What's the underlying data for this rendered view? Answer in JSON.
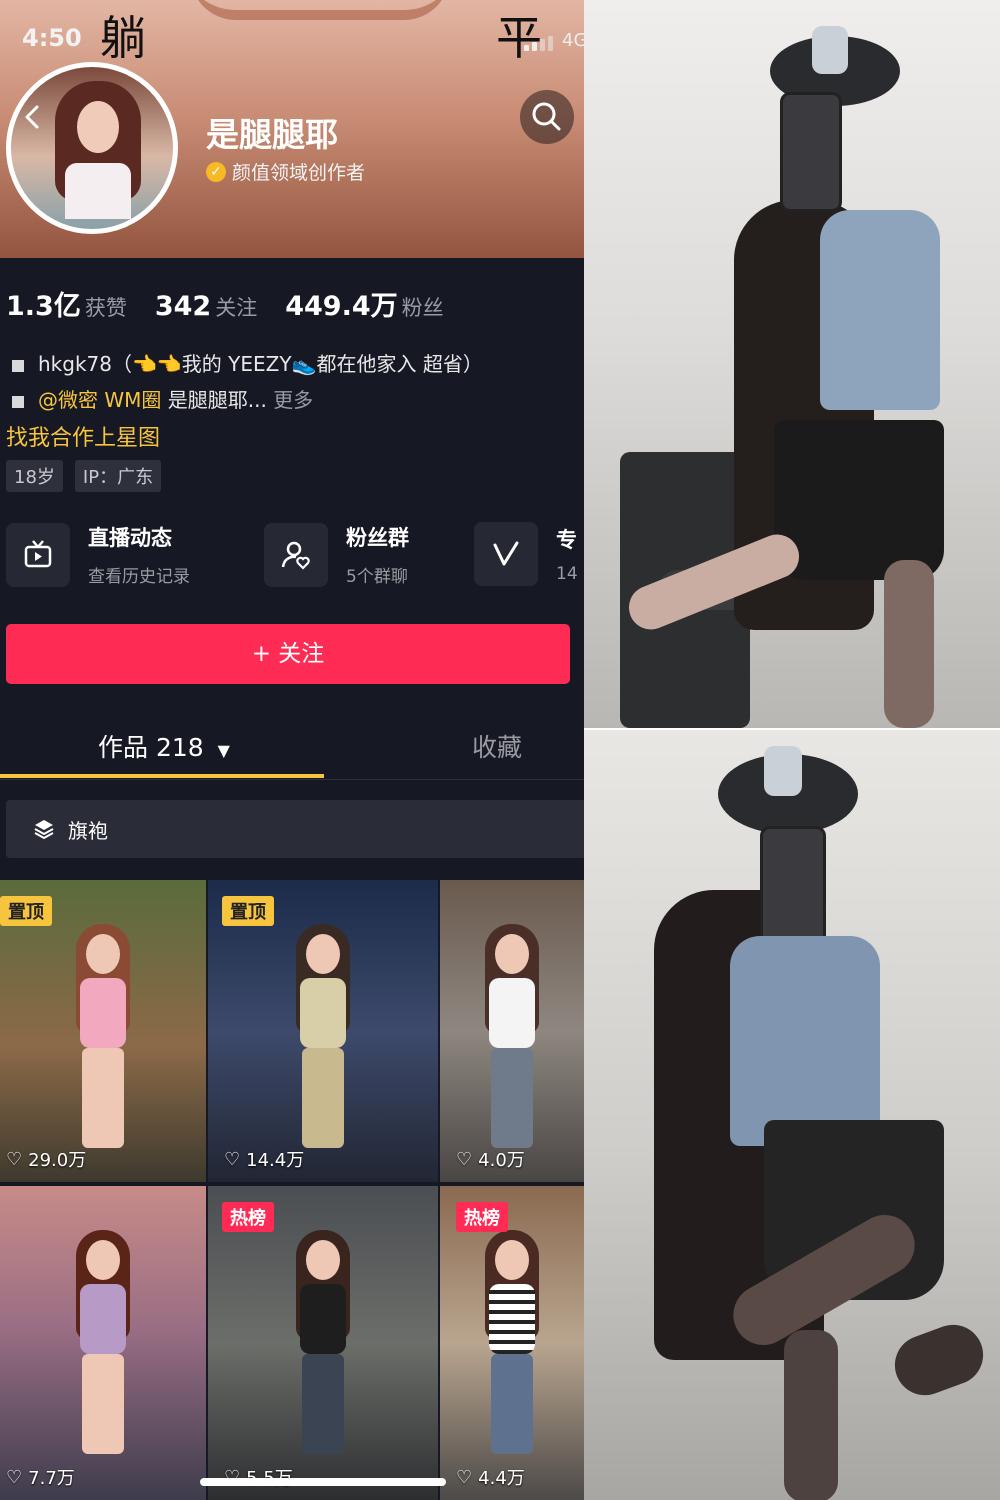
{
  "overlay": {
    "char_left": "躺",
    "char_right": "平"
  },
  "status_bar": {
    "time": "4:50",
    "network": "4G"
  },
  "profile": {
    "name": "是腿腿耶",
    "certification": "颜值领域创作者",
    "stats": [
      {
        "value": "1.3亿",
        "label": "获赞"
      },
      {
        "value": "342",
        "label": "关注"
      },
      {
        "value": "449.4万",
        "label": "粉丝"
      }
    ],
    "bio_line1": "hkgk78（👈👈我的 YEEZY👟都在他家入 超省）",
    "bio_line2_link": "@微密 WM圈",
    "bio_line2_text": "是腿腿耶...",
    "bio_more": "更多",
    "cooperation": "找我合作上星图",
    "tags": [
      "18岁",
      "IP：广东"
    ]
  },
  "entries": [
    {
      "title": "直播动态",
      "sub": "查看历史记录",
      "icon": "live-tv-icon"
    },
    {
      "title": "粉丝群",
      "sub": "5个群聊",
      "icon": "fan-group-icon"
    },
    {
      "title": "专",
      "sub": "14",
      "icon": "v-icon"
    }
  ],
  "follow_button": "+ 关注",
  "tabs": {
    "works": "作品 218",
    "favorites": "收藏"
  },
  "collection": {
    "label": "旗袍",
    "icon": "layers-icon"
  },
  "videos": [
    {
      "badge": "置顶",
      "badge_type": "pin",
      "likes": "29.0万"
    },
    {
      "badge": "置顶",
      "badge_type": "pin",
      "likes": "14.4万"
    },
    {
      "badge": "",
      "badge_type": "",
      "likes": "4.0万"
    },
    {
      "badge": "",
      "badge_type": "",
      "likes": "7.7万"
    },
    {
      "badge": "热榜",
      "badge_type": "hot",
      "likes": "5.5万"
    },
    {
      "badge": "热榜",
      "badge_type": "hot",
      "likes": "4.4万"
    }
  ],
  "colors": {
    "accent_red": "#fe2c55",
    "accent_yellow": "#f7c53d",
    "background": "#161823"
  }
}
